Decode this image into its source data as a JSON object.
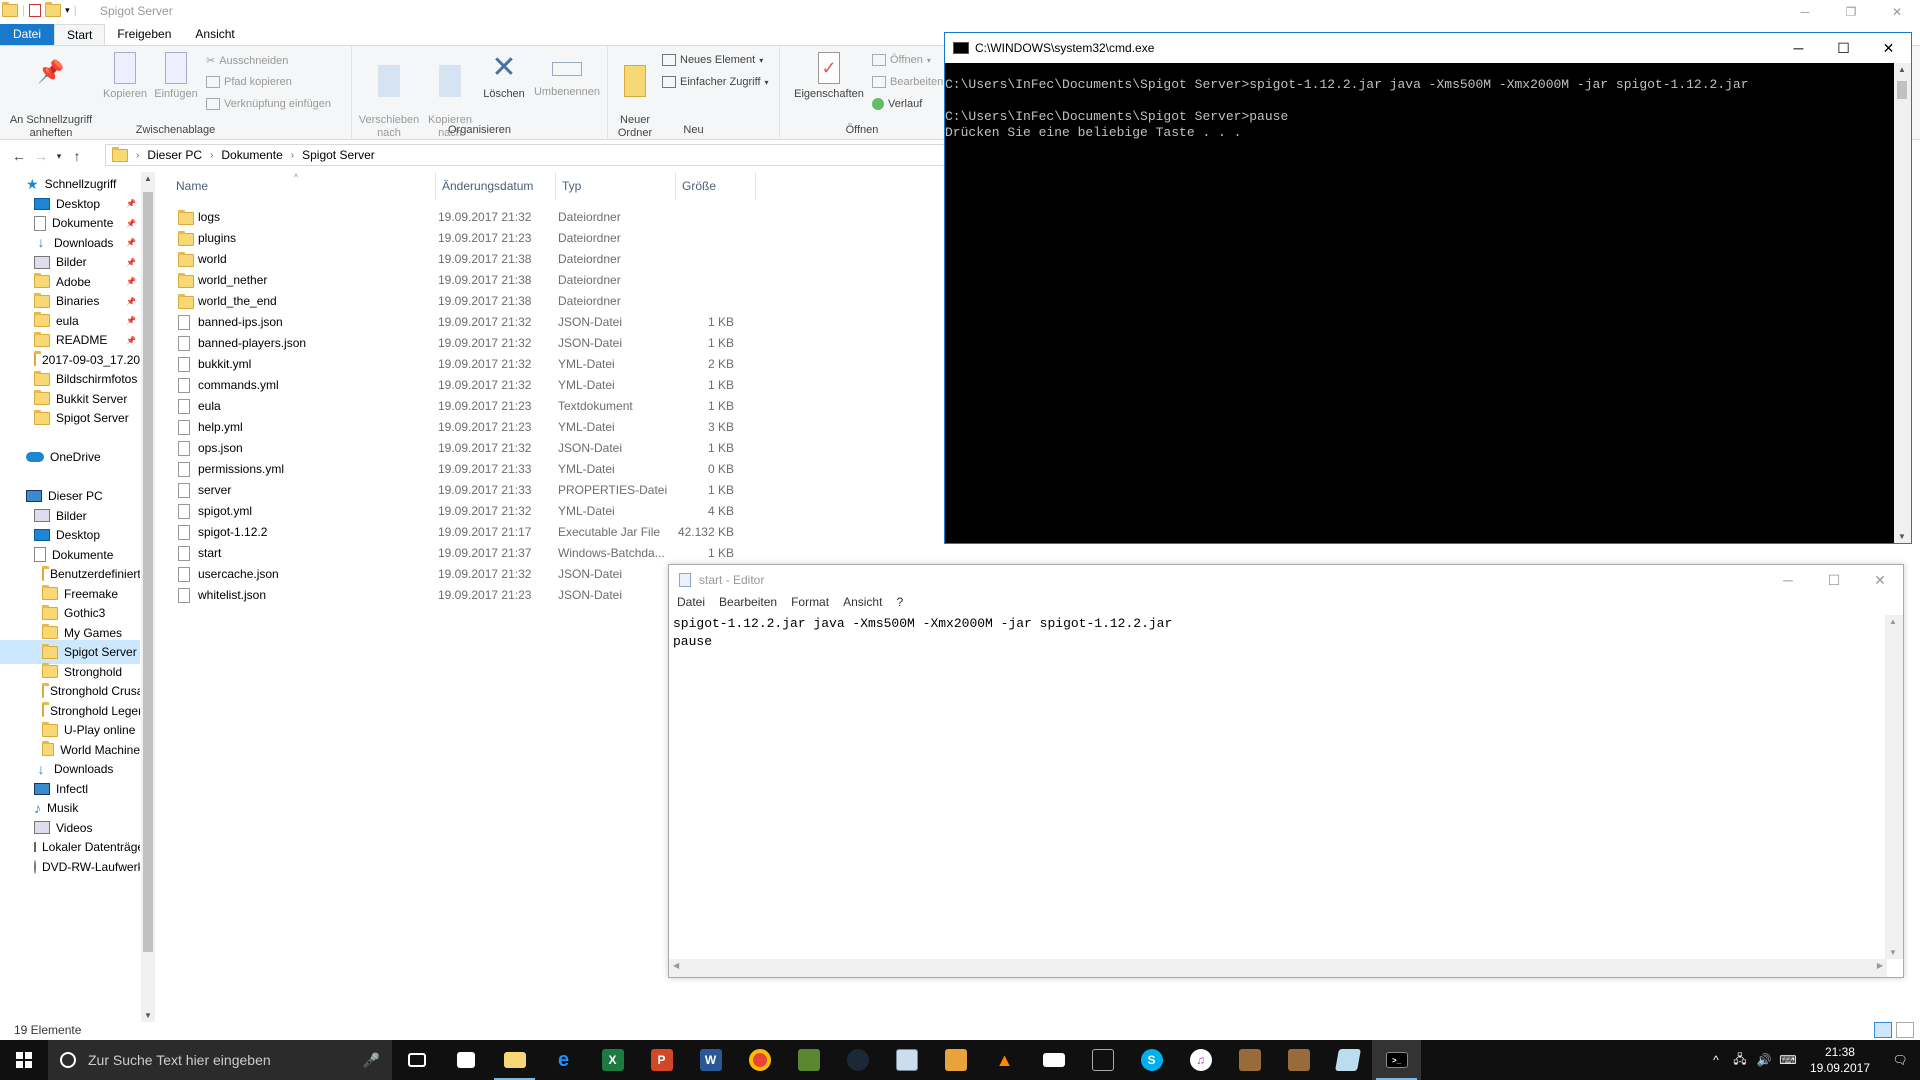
{
  "explorer": {
    "title": "Spigot Server",
    "ribbon_tabs": [
      "Datei",
      "Start",
      "Freigeben",
      "Ansicht"
    ],
    "ribbon": {
      "pin_quick": "An Schnellzugriff\nanheften",
      "copy": "Kopieren",
      "paste": "Einfügen",
      "cut": "Ausschneiden",
      "copy_path": "Pfad kopieren",
      "paste_shortcut": "Verknüpfung einfügen",
      "group_clipboard": "Zwischenablage",
      "move_to": "Verschieben\nnach",
      "copy_to": "Kopieren\nnach",
      "delete": "Löschen",
      "rename": "Umbenennen",
      "group_organize": "Organisieren",
      "new_folder": "Neuer\nOrdner",
      "new_item": "Neues Element",
      "easy_access": "Einfacher Zugriff",
      "group_new": "Neu",
      "properties": "Eigenschaften",
      "open": "Öffnen",
      "edit": "Bearbeiten",
      "history": "Verlauf",
      "group_open": "Öffnen"
    },
    "breadcrumb": [
      "Dieser PC",
      "Dokumente",
      "Spigot Server"
    ],
    "nav": [
      {
        "label": "Schnellzugriff",
        "icon": "star-icon",
        "indent": 0,
        "pin": false
      },
      {
        "label": "Desktop",
        "icon": "desktop-icon",
        "indent": 1,
        "pin": true
      },
      {
        "label": "Dokumente",
        "icon": "documents-icon",
        "indent": 1,
        "pin": true
      },
      {
        "label": "Downloads",
        "icon": "downloads-icon",
        "indent": 1,
        "pin": true
      },
      {
        "label": "Bilder",
        "icon": "pictures-icon",
        "indent": 1,
        "pin": true
      },
      {
        "label": "Adobe",
        "icon": "folder-icon",
        "indent": 1,
        "pin": true
      },
      {
        "label": "Binaries",
        "icon": "folder-icon",
        "indent": 1,
        "pin": true
      },
      {
        "label": "eula",
        "icon": "folder-icon",
        "indent": 1,
        "pin": true
      },
      {
        "label": "README",
        "icon": "folder-icon",
        "indent": 1,
        "pin": true
      },
      {
        "label": "2017-09-03_17.20",
        "icon": "folder-icon",
        "indent": 1,
        "pin": false
      },
      {
        "label": "Bildschirmfotos",
        "icon": "folder-icon",
        "indent": 1,
        "pin": false
      },
      {
        "label": "Bukkit Server",
        "icon": "folder-icon",
        "indent": 1,
        "pin": false
      },
      {
        "label": "Spigot Server",
        "icon": "folder-icon",
        "indent": 1,
        "pin": false
      },
      {
        "label": "",
        "icon": "",
        "indent": 0,
        "pin": false
      },
      {
        "label": "OneDrive",
        "icon": "onedrive-icon",
        "indent": 0,
        "pin": false
      },
      {
        "label": "",
        "icon": "",
        "indent": 0,
        "pin": false
      },
      {
        "label": "Dieser PC",
        "icon": "pc-icon",
        "indent": 0,
        "pin": false
      },
      {
        "label": "Bilder",
        "icon": "pictures-icon",
        "indent": 1,
        "pin": false
      },
      {
        "label": "Desktop",
        "icon": "desktop-icon",
        "indent": 1,
        "pin": false
      },
      {
        "label": "Dokumente",
        "icon": "documents-icon",
        "indent": 1,
        "pin": false
      },
      {
        "label": "Benutzerdefinierte",
        "icon": "folder-icon",
        "indent": 2,
        "pin": false
      },
      {
        "label": "Freemake",
        "icon": "folder-icon",
        "indent": 2,
        "pin": false
      },
      {
        "label": "Gothic3",
        "icon": "folder-icon",
        "indent": 2,
        "pin": false
      },
      {
        "label": "My Games",
        "icon": "folder-icon",
        "indent": 2,
        "pin": false
      },
      {
        "label": "Spigot Server",
        "icon": "folder-icon",
        "indent": 2,
        "pin": false,
        "selected": true
      },
      {
        "label": "Stronghold",
        "icon": "folder-icon",
        "indent": 2,
        "pin": false
      },
      {
        "label": "Stronghold Crusader",
        "icon": "folder-icon",
        "indent": 2,
        "pin": false
      },
      {
        "label": "Stronghold Legends",
        "icon": "folder-icon",
        "indent": 2,
        "pin": false
      },
      {
        "label": "U-Play online",
        "icon": "folder-icon",
        "indent": 2,
        "pin": false
      },
      {
        "label": "World Machine",
        "icon": "folder-icon",
        "indent": 2,
        "pin": false
      },
      {
        "label": "Downloads",
        "icon": "downloads-icon",
        "indent": 1,
        "pin": false
      },
      {
        "label": "Infectl",
        "icon": "pc-icon",
        "indent": 1,
        "pin": false
      },
      {
        "label": "Musik",
        "icon": "music-icon",
        "indent": 1,
        "pin": false
      },
      {
        "label": "Videos",
        "icon": "videos-icon",
        "indent": 1,
        "pin": false
      },
      {
        "label": "Lokaler Datenträger",
        "icon": "disk-icon",
        "indent": 1,
        "pin": false
      },
      {
        "label": "DVD-RW-Laufwerk",
        "icon": "dvd-icon",
        "indent": 1,
        "pin": false
      }
    ],
    "columns": {
      "name": "Name",
      "date": "Änderungsdatum",
      "type": "Typ",
      "size": "Größe"
    },
    "files": [
      {
        "name": "logs",
        "date": "19.09.2017 21:32",
        "type": "Dateiordner",
        "size": "",
        "kind": "folder"
      },
      {
        "name": "plugins",
        "date": "19.09.2017 21:23",
        "type": "Dateiordner",
        "size": "",
        "kind": "folder"
      },
      {
        "name": "world",
        "date": "19.09.2017 21:38",
        "type": "Dateiordner",
        "size": "",
        "kind": "folder"
      },
      {
        "name": "world_nether",
        "date": "19.09.2017 21:38",
        "type": "Dateiordner",
        "size": "",
        "kind": "folder"
      },
      {
        "name": "world_the_end",
        "date": "19.09.2017 21:38",
        "type": "Dateiordner",
        "size": "",
        "kind": "folder"
      },
      {
        "name": "banned-ips.json",
        "date": "19.09.2017 21:32",
        "type": "JSON-Datei",
        "size": "1 KB",
        "kind": "file"
      },
      {
        "name": "banned-players.json",
        "date": "19.09.2017 21:32",
        "type": "JSON-Datei",
        "size": "1 KB",
        "kind": "file"
      },
      {
        "name": "bukkit.yml",
        "date": "19.09.2017 21:32",
        "type": "YML-Datei",
        "size": "2 KB",
        "kind": "file"
      },
      {
        "name": "commands.yml",
        "date": "19.09.2017 21:32",
        "type": "YML-Datei",
        "size": "1 KB",
        "kind": "file"
      },
      {
        "name": "eula",
        "date": "19.09.2017 21:23",
        "type": "Textdokument",
        "size": "1 KB",
        "kind": "file"
      },
      {
        "name": "help.yml",
        "date": "19.09.2017 21:23",
        "type": "YML-Datei",
        "size": "3 KB",
        "kind": "file"
      },
      {
        "name": "ops.json",
        "date": "19.09.2017 21:32",
        "type": "JSON-Datei",
        "size": "1 KB",
        "kind": "file"
      },
      {
        "name": "permissions.yml",
        "date": "19.09.2017 21:33",
        "type": "YML-Datei",
        "size": "0 KB",
        "kind": "file"
      },
      {
        "name": "server",
        "date": "19.09.2017 21:33",
        "type": "PROPERTIES-Datei",
        "size": "1 KB",
        "kind": "file"
      },
      {
        "name": "spigot.yml",
        "date": "19.09.2017 21:32",
        "type": "YML-Datei",
        "size": "4 KB",
        "kind": "file"
      },
      {
        "name": "spigot-1.12.2",
        "date": "19.09.2017 21:17",
        "type": "Executable Jar File",
        "size": "42.132 KB",
        "kind": "jar"
      },
      {
        "name": "start",
        "date": "19.09.2017 21:37",
        "type": "Windows-Batchda...",
        "size": "1 KB",
        "kind": "bat"
      },
      {
        "name": "usercache.json",
        "date": "19.09.2017 21:32",
        "type": "JSON-Datei",
        "size": "1 KB",
        "kind": "file"
      },
      {
        "name": "whitelist.json",
        "date": "19.09.2017 21:23",
        "type": "JSON-Datei",
        "size": "1 KB",
        "kind": "file"
      }
    ],
    "status": "19 Elemente"
  },
  "cmd": {
    "title": "C:\\WINDOWS\\system32\\cmd.exe",
    "output": "C:\\Users\\InFec\\Documents\\Spigot Server>spigot-1.12.2.jar java -Xms500M -Xmx2000M -jar spigot-1.12.2.jar\n\nC:\\Users\\InFec\\Documents\\Spigot Server>pause\nDrücken Sie eine beliebige Taste . . ."
  },
  "notepad": {
    "title": "start - Editor",
    "menu": [
      "Datei",
      "Bearbeiten",
      "Format",
      "Ansicht",
      "?"
    ],
    "content": "spigot-1.12.2.jar java -Xms500M -Xmx2000M -jar spigot-1.12.2.jar\npause"
  },
  "taskbar": {
    "search_placeholder": "Zur Suche Text hier eingeben",
    "time": "21:38",
    "date": "19.09.2017"
  }
}
